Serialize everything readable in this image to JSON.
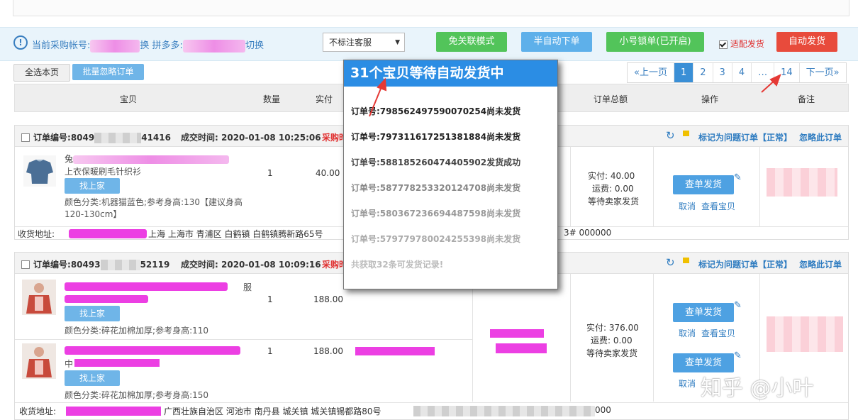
{
  "account": {
    "purchase_label": "当前采购帐号:",
    "switch1": "换",
    "platform_label": "拼多多:",
    "switch2": "切换",
    "service_select": "不标注客服",
    "btn_free": "免关联模式",
    "btn_semi": "半自动下单",
    "btn_lock": "小号锁单(已开启)",
    "adapt_label": "适配发货",
    "btn_auto": "自动发货"
  },
  "toolbar": {
    "select_page": "全选本页",
    "batch_ignore": "批量忽略订单"
  },
  "pager": [
    "«上一页",
    "1",
    "2",
    "3",
    "4",
    "…",
    "14",
    "下一页»"
  ],
  "table_header": {
    "item": "宝贝",
    "qty": "数量",
    "paid": "实付",
    "total": "订单总额",
    "ops": "操作",
    "note": "备注"
  },
  "orders": [
    {
      "number_label": "订单编号:",
      "number_prefix": "8049",
      "number_suffix": "41416",
      "time_label": "成交时间:",
      "time": "2020-01-08 10:25:06",
      "purchase_tag": "采购时",
      "flag_issue": "标记为问题订单【正常】",
      "ignore": "忽略此订单",
      "items": [
        {
          "title_line": "上衣保暖刷毛针织衫",
          "find_label": "找上家",
          "attrs": "颜色分类:机器猫蓝色;参考身高:130【建议身高120-130cm】",
          "qty": "1",
          "price": "40.00"
        }
      ],
      "paid_label": "实付:",
      "paid": "40.00",
      "shipping_label": "运费:",
      "shipping": "0.00",
      "status": "等待卖家发货",
      "btn_check": "查单发货",
      "cancel": "取消",
      "view": "查看宝贝",
      "addr_label": "收货地址:",
      "addr": "上海 上海市 青浦区 白鹤镇 白鹤镇腾新路65号",
      "addr_tail": "3# 000000"
    },
    {
      "number_label": "订单编号:",
      "number_prefix": "80493",
      "number_suffix": "52119",
      "time_label": "成交时间:",
      "time": "2020-01-08 10:09:16",
      "purchase_tag": "采购时",
      "flag_issue": "标记为问题订单【正常】",
      "ignore": "忽略此订单",
      "items": [
        {
          "title_line": "服",
          "find_label": "找上家",
          "attrs": "颜色分类:碎花加棉加厚;参考身高:110",
          "qty": "1",
          "price": "188.00"
        },
        {
          "title_line": "中",
          "find_label": "找上家",
          "attrs": "颜色分类:碎花加棉加厚;参考身高:150",
          "qty": "1",
          "price": "188.00"
        }
      ],
      "paid_label": "实付:",
      "paid": "376.00",
      "shipping_label": "运费:",
      "shipping": "0.00",
      "status": "等待卖家发货",
      "btn_check": "查单发货",
      "cancel": "取消",
      "view": "查看宝贝",
      "addr_label": "收货地址:",
      "addr": "广西壮族自治区 河池市 南丹县 城关镇 城关镇锡都路80号",
      "addr_tail": "000"
    }
  ],
  "popup": {
    "title": "31个宝贝等待自动发货中",
    "lines": [
      "订单号:798562497590070254尚未发货",
      "订单号:797311617251381884尚未发货",
      "订单号:588185260474405902发货成功",
      "订单号:587778253320124708尚未发货",
      "订单号:580367236694487598尚未发货",
      "订单号:579779780024255398尚未发货"
    ],
    "footer": "共获取32条可发货记录!"
  },
  "watermark": "知乎 @小叶",
  "colors": {
    "green": "#52c45a",
    "blue": "#5eb0ea",
    "red": "#e84b3c",
    "popup_header": "#2b8de4"
  }
}
